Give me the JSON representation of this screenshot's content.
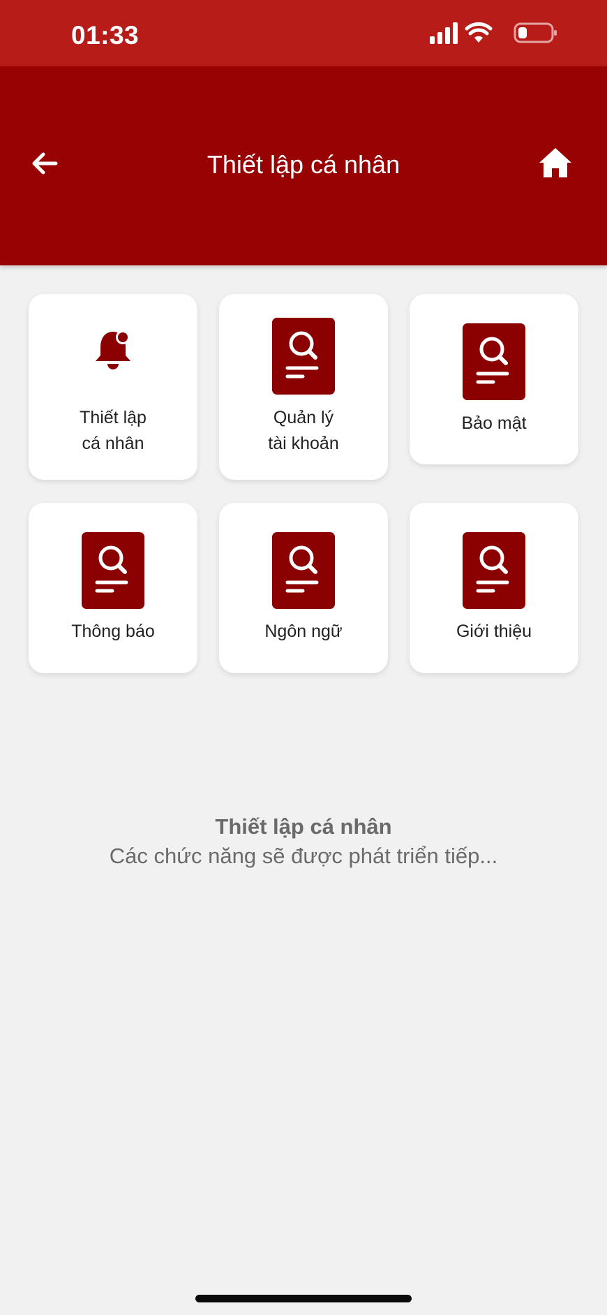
{
  "status_bar": {
    "time": "01:33"
  },
  "header": {
    "title": "Thiết lập cá nhân"
  },
  "menu": {
    "items": [
      {
        "line1": "Thiết lập",
        "line2": "cá nhân"
      },
      {
        "line1": "Quản lý",
        "line2": "tài khoản"
      },
      {
        "label": "Bảo mật"
      },
      {
        "label": "Thông báo"
      },
      {
        "label": "Ngôn ngữ"
      },
      {
        "label": "Giới thiệu"
      }
    ]
  },
  "footer": {
    "title": "Thiết lập cá nhân",
    "subtitle": "Các chức năng sẽ được phát triển tiếp..."
  },
  "colors": {
    "status_bar": "#b71c18",
    "header": "#990202",
    "icon": "#8b0000",
    "background": "#f1f1f1"
  }
}
